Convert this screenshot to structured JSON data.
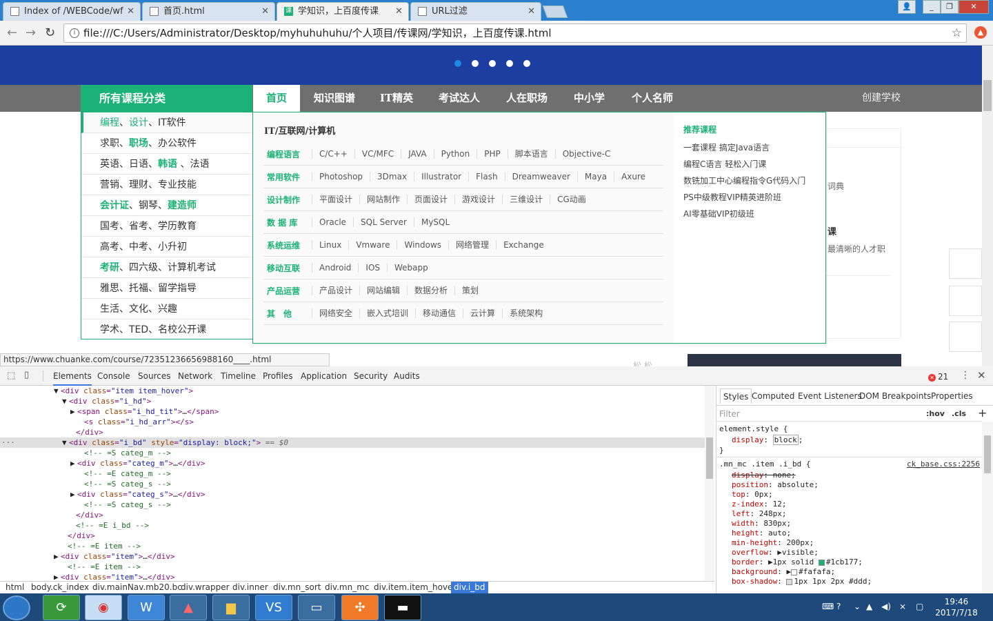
{
  "browser": {
    "tabs": [
      {
        "title": "Index of /WEBCode/wf"
      },
      {
        "title": "首页.html"
      },
      {
        "title": "学知识，上百度传课"
      },
      {
        "title": "URL过滤"
      }
    ],
    "active_tab_icon": "课",
    "address": "file:///C:/Users/Administrator/Desktop/myhuhuhuhu/个人项目/传课网/学知识，上百度传课.html",
    "status_url": "https://www.chuanke.com/course/72351236656988160____.html"
  },
  "site": {
    "all_categories": "所有课程分类",
    "nav": [
      "首页",
      "知识图谱",
      "IT精英",
      "考试达人",
      "人在职场",
      "中小学",
      "个人名师"
    ],
    "create_school": "创建学校",
    "categories": [
      {
        "hi": "编程",
        "sep": "、",
        "hi2": "设计",
        "rest": "、IT软件"
      },
      {
        "pre": "求职、",
        "hi": "职场",
        "rest": "、办公软件"
      },
      {
        "pre": "英语、日语、",
        "hi": "韩语",
        "rest": " 、法语"
      },
      {
        "pre": "营销、理财、专业技能"
      },
      {
        "hi": "会计证",
        "rest": "、钢琴、",
        "hi2": "建造师"
      },
      {
        "pre": "国考、省考、学历教育"
      },
      {
        "pre": "高考、中考、小升初"
      },
      {
        "hi": "考研",
        "rest": "、四六级、计算机考试"
      },
      {
        "pre": "雅思、托福、留学指导"
      },
      {
        "pre": "生活、文化、兴趣"
      },
      {
        "pre": "学术、TED、名校公开课"
      }
    ],
    "panel_title": "IT/互联网/计算机",
    "panel_rows": [
      {
        "label": "编程语言",
        "items": [
          "C/C++",
          "VC/MFC",
          "JAVA",
          "Python",
          "PHP",
          "脚本语言",
          "Objective-C"
        ]
      },
      {
        "label": "常用软件",
        "items": [
          "Photoshop",
          "3Dmax",
          "Illustrator",
          "Flash",
          "Dreamweaver",
          "Maya",
          "Axure"
        ]
      },
      {
        "label": "设计制作",
        "items": [
          "平面设计",
          "网站制作",
          "页面设计",
          "游戏设计",
          "三维设计",
          "CG动画"
        ]
      },
      {
        "label": "数 据 库",
        "items": [
          "Oracle",
          "SQL Server",
          "MySQL"
        ]
      },
      {
        "label": "系统运维",
        "items": [
          "Linux",
          "Vmware",
          "Windows",
          "网络管理",
          "Exchange"
        ]
      },
      {
        "label": "移动互联",
        "items": [
          "Android",
          "IOS",
          "Webapp"
        ]
      },
      {
        "label": "产品运营",
        "items": [
          "产品设计",
          "网站编辑",
          "数据分析",
          "策划"
        ]
      },
      {
        "label": "其　他",
        "items": [
          "网络安全",
          "嵌入式培训",
          "移动通信",
          "云计算",
          "系统架构"
        ]
      }
    ],
    "recommend_title": "推荐课程",
    "recommend": [
      "一套课程 搞定Java语言",
      "编程C语言 轻松入门课",
      "数铣加工中心编程指令G代码入门",
      "PS中级教程VIP精英进阶班",
      "AI零基础VIP初级班"
    ],
    "right_fragments": [
      "词典",
      "课",
      "最清晰的人才职"
    ],
    "bottom_fragment": "松  松"
  },
  "devtools": {
    "tabs": [
      "Elements",
      "Console",
      "Sources",
      "Network",
      "Timeline",
      "Profiles",
      "Application",
      "Security",
      "Audits"
    ],
    "error_count": "21",
    "dom_lines": [
      {
        "tag": "div",
        "cls": "item item_hover",
        "arrow": "▼",
        "indent": 88,
        "open": true
      },
      {
        "tag": "div",
        "cls": "i_hd",
        "arrow": "▼",
        "indent": 100,
        "open": true
      },
      {
        "tag": "span",
        "cls": "i_hd_tit",
        "arrow": "▶",
        "indent": 112,
        "collapsed": true
      },
      {
        "tag": "s",
        "cls": "i_hd_arr",
        "arrow": "",
        "indent": 122,
        "selfclose": true
      },
      {
        "close": "div",
        "indent": 110
      },
      {
        "tag": "div",
        "cls": "i_bd",
        "style": "display: block;",
        "arrow": "▼",
        "indent": 100,
        "selected": true
      },
      {
        "comment": "=S categ_m",
        "indent": 122
      },
      {
        "tag": "div",
        "cls": "categ_m",
        "arrow": "▶",
        "indent": 112,
        "collapsed": true
      },
      {
        "comment": "=E categ_m",
        "indent": 122
      },
      {
        "comment": "=S categ_s",
        "indent": 122
      },
      {
        "tag": "div",
        "cls": "categ_s",
        "arrow": "▶",
        "indent": 112,
        "collapsed": true
      },
      {
        "comment": "=S categ_s",
        "indent": 122
      },
      {
        "close": "div",
        "indent": 110
      },
      {
        "comment": "=E i_bd",
        "indent": 110
      },
      {
        "close": "div",
        "indent": 98
      },
      {
        "comment": "=E item",
        "indent": 98
      },
      {
        "tag": "div",
        "cls": "item",
        "arrow": "▶",
        "indent": 88,
        "collapsed": true
      },
      {
        "comment": "=E item",
        "indent": 98
      },
      {
        "tag": "div",
        "cls": "item",
        "arrow": "▶",
        "indent": 88,
        "collapsed": true
      }
    ],
    "selected_suffix": "== $0",
    "breadcrumbs": [
      "html",
      "body.ck_index",
      "div.mainNav.mb20.bc",
      "div.wrapper",
      "div.inner",
      "div.mn_sort",
      "div.mn_mc",
      "div.item.item_hover",
      "div.i_bd"
    ],
    "styles_tabs": [
      "Styles",
      "Computed",
      "Event Listeners",
      "DOM Breakpoints",
      "Properties"
    ],
    "filter_placeholder": "Filter",
    "hov": ":hov",
    "cls": ".cls",
    "plus": "+",
    "element_style_selector": "element.style {",
    "element_style_prop": "display",
    "element_style_val": "block",
    "close_brace": "}",
    "rule_selector": ".mn_mc .item .i_bd {",
    "rule_source": "ck_base.css:2256",
    "rule_props": [
      {
        "p": "display",
        "v": "none;",
        "struck": true
      },
      {
        "p": "position",
        "v": "absolute;"
      },
      {
        "p": "top",
        "v": "0px;"
      },
      {
        "p": "z-index",
        "v": "12;"
      },
      {
        "p": "left",
        "v": "248px;"
      },
      {
        "p": "width",
        "v": "830px;"
      },
      {
        "p": "height",
        "v": "auto;"
      },
      {
        "p": "min-height",
        "v": "200px;"
      },
      {
        "p": "overflow",
        "v": "▶visible;"
      },
      {
        "p": "border",
        "v": "▶1px solid ",
        "color": "#1cb177",
        "after": "#1cb177;"
      },
      {
        "p": "background",
        "v": "▶",
        "color": "#fafafa",
        "after": "#fafafa;"
      },
      {
        "p": "box-shadow",
        "v": "",
        "color": "#dddddd",
        "after": "1px 1px 2px #ddd;"
      }
    ]
  },
  "taskbar": {
    "time": "19:46",
    "date": "2017/7/18"
  }
}
